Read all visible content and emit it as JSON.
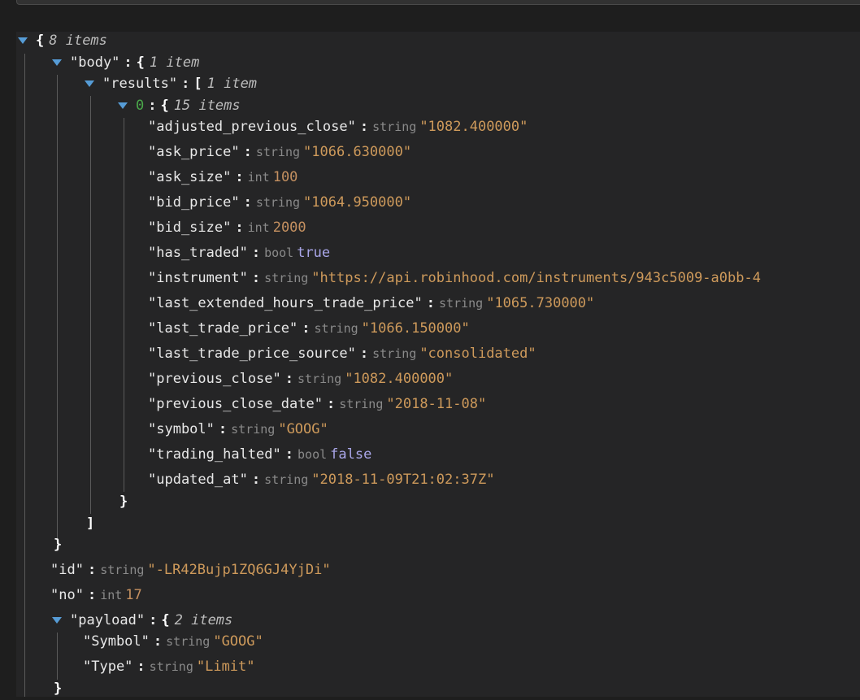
{
  "root": {
    "open": "{",
    "count": "8 items"
  },
  "body": {
    "key": "\"body\"",
    "open": "{",
    "count": "1 item",
    "close": "}"
  },
  "results": {
    "key": "\"results\"",
    "open": "[",
    "count": "1 item",
    "close": "]"
  },
  "item0": {
    "key": "0",
    "open": "{",
    "count": "15 items",
    "close": "}"
  },
  "fields": [
    {
      "key": "\"adjusted_previous_close\"",
      "type": "string",
      "value": "\"1082.400000\""
    },
    {
      "key": "\"ask_price\"",
      "type": "string",
      "value": "\"1066.630000\""
    },
    {
      "key": "\"ask_size\"",
      "type": "int",
      "value": "100"
    },
    {
      "key": "\"bid_price\"",
      "type": "string",
      "value": "\"1064.950000\""
    },
    {
      "key": "\"bid_size\"",
      "type": "int",
      "value": "2000"
    },
    {
      "key": "\"has_traded\"",
      "type": "bool",
      "value": "true"
    },
    {
      "key": "\"instrument\"",
      "type": "string",
      "value": "\"https://api.robinhood.com/instruments/943c5009-a0bb-4"
    },
    {
      "key": "\"last_extended_hours_trade_price\"",
      "type": "string",
      "value": "\"1065.730000\""
    },
    {
      "key": "\"last_trade_price\"",
      "type": "string",
      "value": "\"1066.150000\""
    },
    {
      "key": "\"last_trade_price_source\"",
      "type": "string",
      "value": "\"consolidated\""
    },
    {
      "key": "\"previous_close\"",
      "type": "string",
      "value": "\"1082.400000\""
    },
    {
      "key": "\"previous_close_date\"",
      "type": "string",
      "value": "\"2018-11-08\""
    },
    {
      "key": "\"symbol\"",
      "type": "string",
      "value": "\"GOOG\""
    },
    {
      "key": "\"trading_halted\"",
      "type": "bool",
      "value": "false"
    },
    {
      "key": "\"updated_at\"",
      "type": "string",
      "value": "\"2018-11-09T21:02:37Z\""
    }
  ],
  "id": {
    "key": "\"id\"",
    "type": "string",
    "value": "\"-LR42Bujp1ZQ6GJ4YjDi\""
  },
  "no": {
    "key": "\"no\"",
    "type": "int",
    "value": "17"
  },
  "payload": {
    "key": "\"payload\"",
    "open": "{",
    "count": "2 items",
    "close": "}"
  },
  "payload_fields": [
    {
      "key": "\"Symbol\"",
      "type": "string",
      "value": "\"GOOG\""
    },
    {
      "key": "\"Type\"",
      "type": "string",
      "value": "\"Limit\""
    }
  ],
  "colon": ":",
  "colors": {
    "background": "#1e1e1e",
    "panel": "#252526",
    "caret": "#569cd6",
    "string": "#ce9a5b",
    "bool": "#a9a6e8",
    "index": "#4aa84a"
  }
}
